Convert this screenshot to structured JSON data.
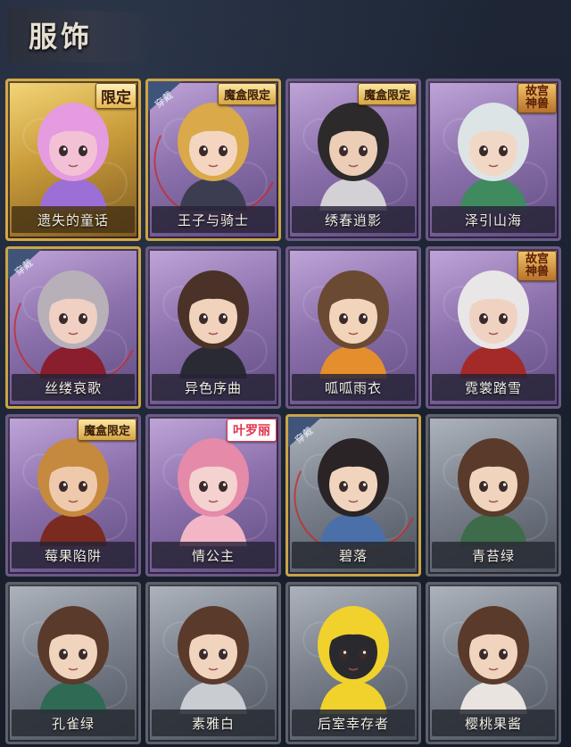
{
  "section": {
    "title": "服饰"
  },
  "cards": [
    {
      "name": "遗失的童话",
      "frame": "gold",
      "badge": "限定",
      "badge_type": "limited",
      "equipped": false,
      "skin": "#f2c1d6",
      "hair": "#e59be0",
      "accent": "#9b6fd6"
    },
    {
      "name": "王子与骑士",
      "frame": "purple",
      "badge": "魔盒限定",
      "badge_type": "box",
      "equipped": true,
      "equip_label": "穿戴",
      "skin": "#f4d5bf",
      "hair": "#d9a94a",
      "accent": "#3d3d52"
    },
    {
      "name": "绣春逍影",
      "frame": "purple",
      "badge": "魔盒限定",
      "badge_type": "box",
      "equipped": false,
      "skin": "#eccdb5",
      "hair": "#2d2a2c",
      "accent": "#d3d0d6"
    },
    {
      "name": "泽引山海",
      "frame": "purple",
      "badge": "故宫神兽",
      "badge_type": "museum",
      "equipped": false,
      "skin": "#f1d8c6",
      "hair": "#dde4e6",
      "accent": "#3f8a5e"
    },
    {
      "name": "丝缕哀歌",
      "frame": "purple",
      "badge": "",
      "badge_type": "",
      "equipped": true,
      "equip_label": "穿戴",
      "skin": "#efd0c3",
      "hair": "#b8b0b8",
      "accent": "#8a1e2e"
    },
    {
      "name": "异色序曲",
      "frame": "purple",
      "badge": "",
      "badge_type": "",
      "equipped": false,
      "skin": "#f0d2bd",
      "hair": "#4a3228",
      "accent": "#2a2a35"
    },
    {
      "name": "呱呱雨衣",
      "frame": "purple",
      "badge": "",
      "badge_type": "",
      "equipped": false,
      "skin": "#f2d4bb",
      "hair": "#6a4a33",
      "accent": "#e58e2e"
    },
    {
      "name": "霓裳踏雪",
      "frame": "purple",
      "badge": "故宫神兽",
      "badge_type": "museum",
      "equipped": false,
      "skin": "#efd2c2",
      "hair": "#e9e6e8",
      "accent": "#a42a2a"
    },
    {
      "name": "莓果陷阱",
      "frame": "purple",
      "badge": "魔盒限定",
      "badge_type": "box",
      "equipped": false,
      "skin": "#eec9ac",
      "hair": "#c68a3e",
      "accent": "#7a2a1e"
    },
    {
      "name": "情公主",
      "frame": "purple",
      "badge": "叶罗丽",
      "badge_type": "lolita",
      "equipped": false,
      "skin": "#f3d2cf",
      "hair": "#e58aa8",
      "accent": "#f2b6c6"
    },
    {
      "name": "碧落",
      "frame": "gray",
      "badge": "",
      "badge_type": "",
      "equipped": true,
      "equip_label": "穿戴",
      "skin": "#f0d4bd",
      "hair": "#2a2426",
      "accent": "#4b6fa8"
    },
    {
      "name": "青苔绿",
      "frame": "gray",
      "badge": "",
      "badge_type": "",
      "equipped": false,
      "skin": "#f0d4be",
      "hair": "#5a3a2a",
      "accent": "#3e6b4a"
    },
    {
      "name": "孔雀绿",
      "frame": "gray",
      "badge": "",
      "badge_type": "",
      "equipped": false,
      "skin": "#f0d4be",
      "hair": "#5a3a2a",
      "accent": "#2f6a55"
    },
    {
      "name": "素雅白",
      "frame": "gray",
      "badge": "",
      "badge_type": "",
      "equipped": false,
      "skin": "#f0d4be",
      "hair": "#5a3a2a",
      "accent": "#c9ccd0"
    },
    {
      "name": "后室幸存者",
      "frame": "gray",
      "badge": "",
      "badge_type": "",
      "equipped": false,
      "skin": "#2a2a2e",
      "hair": "#f1d22c",
      "accent": "#f1d22c"
    },
    {
      "name": "樱桃果酱",
      "frame": "gray",
      "badge": "",
      "badge_type": "",
      "equipped": false,
      "skin": "#f0d4be",
      "hair": "#5a3a2a",
      "accent": "#e9e4df"
    }
  ]
}
